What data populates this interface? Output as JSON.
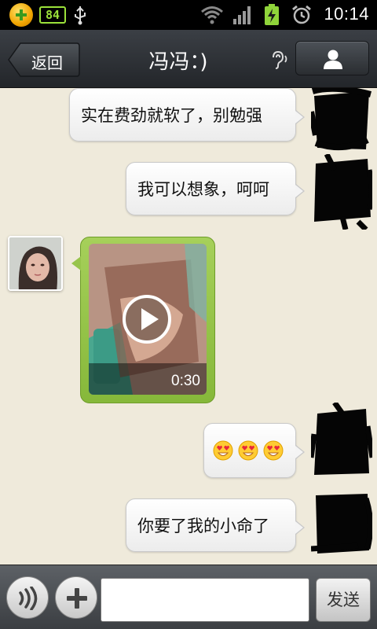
{
  "status_bar": {
    "badge": "84",
    "time": "10:14"
  },
  "header": {
    "back_label": "返回",
    "title": "冯冯：)"
  },
  "messages": [
    {
      "side": "out",
      "text": "实在费劲就软了，别勉强"
    },
    {
      "side": "out",
      "text": "我可以想象，呵呵"
    },
    {
      "side": "in",
      "type": "video",
      "duration": "0:30"
    },
    {
      "side": "out",
      "type": "emoji",
      "emojis": [
        "heart-eyes-emoji",
        "heart-eyes-emoji",
        "heart-eyes-emoji"
      ]
    },
    {
      "side": "out",
      "text": "你要了我的小命了"
    }
  ],
  "input_bar": {
    "placeholder": "",
    "send_label": "发送"
  },
  "colors": {
    "chat_bg": "#efeadb",
    "video_bubble": "#97c44b",
    "title_bar": "#2c2f33"
  }
}
